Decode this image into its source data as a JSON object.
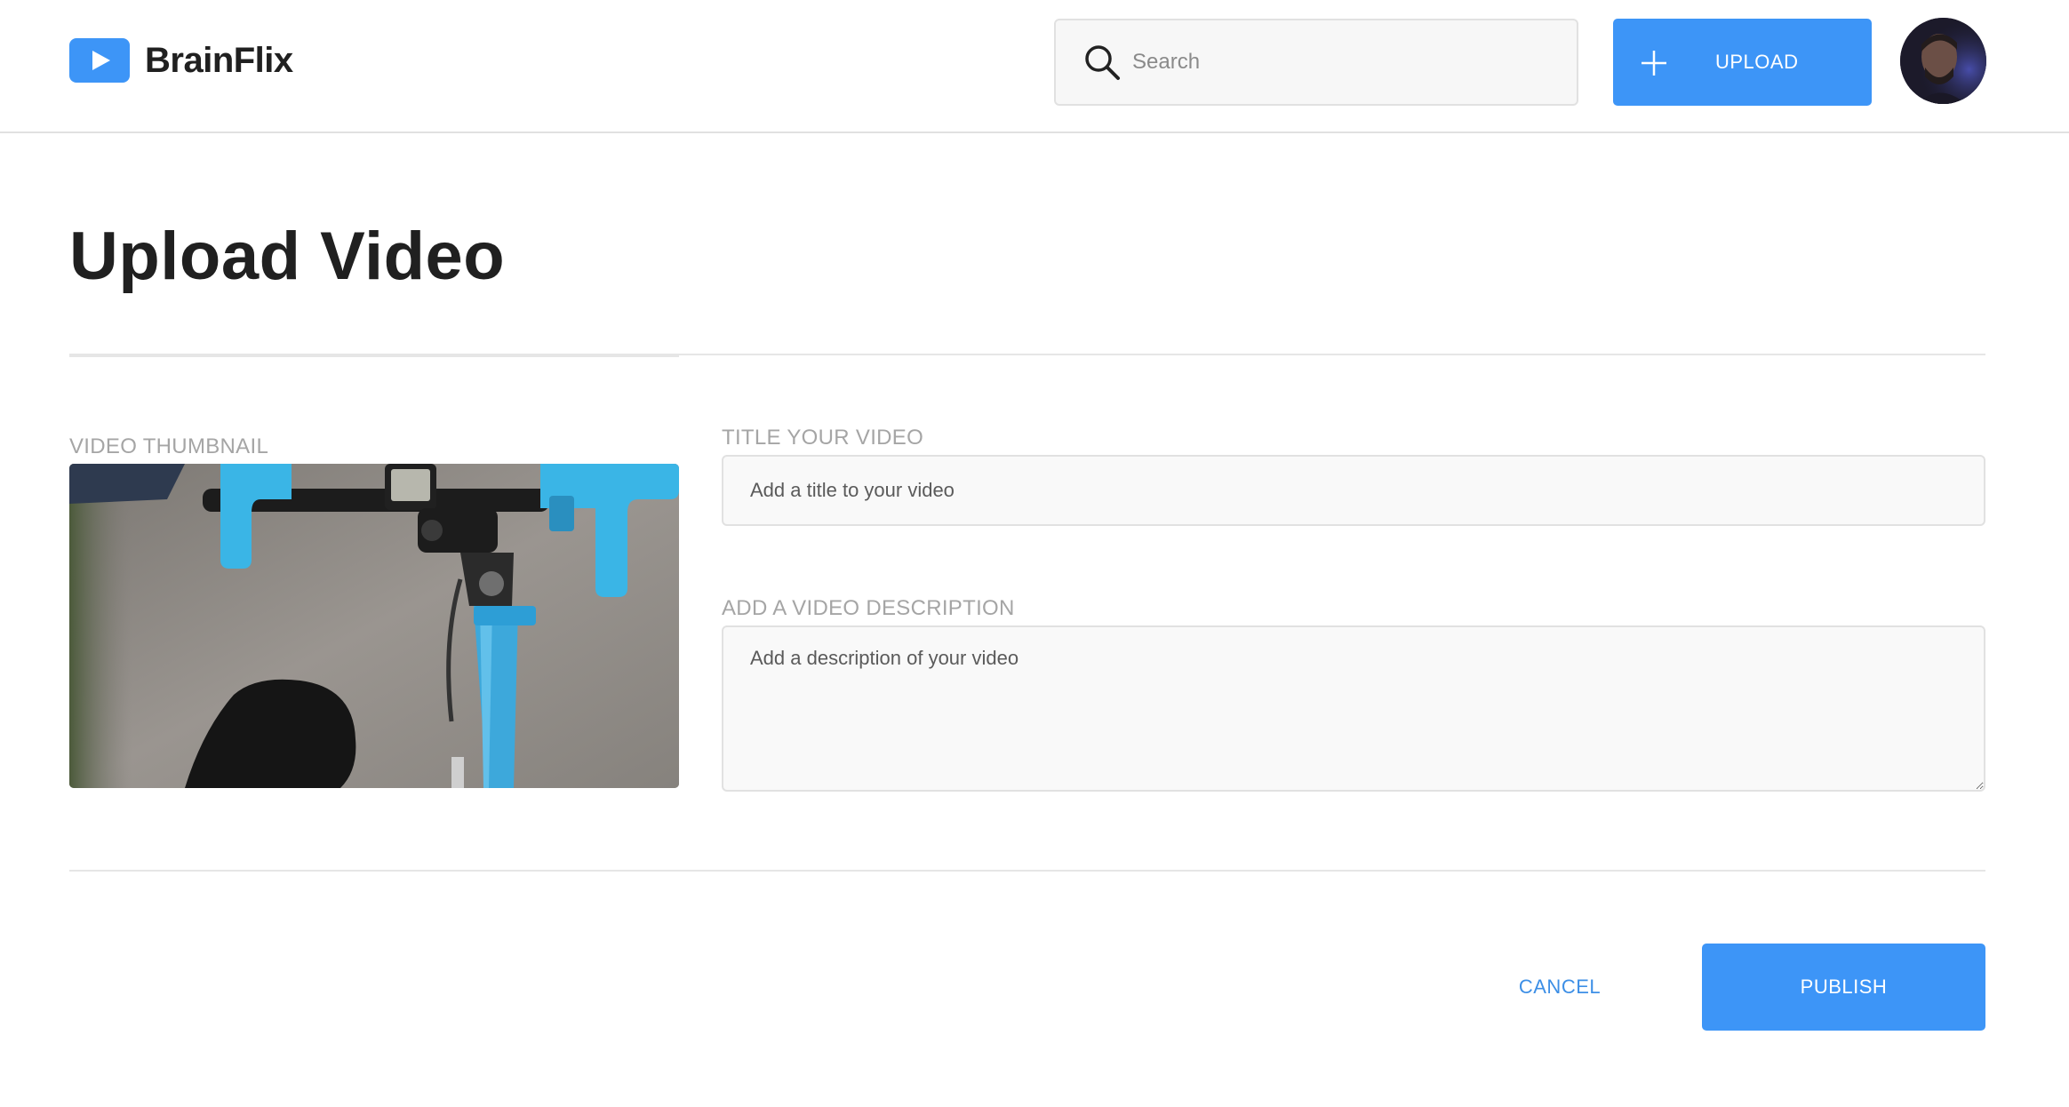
{
  "app": {
    "name": "BrainFlix",
    "brand_color": "#3d95f7"
  },
  "header": {
    "search": {
      "placeholder": "Search",
      "value": "",
      "icon": "search-icon"
    },
    "upload_button": {
      "label": "UPLOAD",
      "icon": "plus-icon"
    },
    "avatar": "user-avatar"
  },
  "page": {
    "title": "Upload Video"
  },
  "form": {
    "thumbnail": {
      "label": "VIDEO THUMBNAIL",
      "image": "bike-handlebar-thumbnail"
    },
    "title_field": {
      "label": "TITLE YOUR VIDEO",
      "placeholder": "Add a title to your video",
      "value": ""
    },
    "description_field": {
      "label": "ADD A VIDEO DESCRIPTION",
      "placeholder": "Add a description of your video",
      "value": ""
    }
  },
  "actions": {
    "cancel_label": "CANCEL",
    "publish_label": "PUBLISH"
  }
}
